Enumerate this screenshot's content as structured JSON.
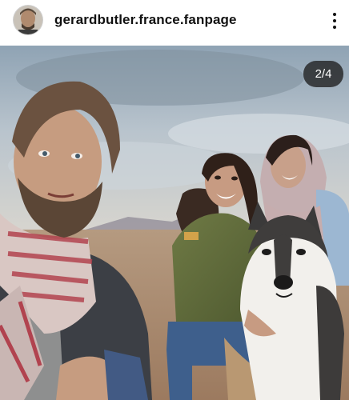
{
  "post": {
    "username": "gerardbutler.france.fanpage",
    "avatar_icon": "profile-avatar",
    "more_icon": "more-vertical-icon",
    "carousel_counter": "2/4",
    "carousel": {
      "current": 2,
      "total": 4
    }
  },
  "colors": {
    "text": "#111111",
    "counter_bg": "#1e1e1e",
    "background": "#ffffff"
  }
}
